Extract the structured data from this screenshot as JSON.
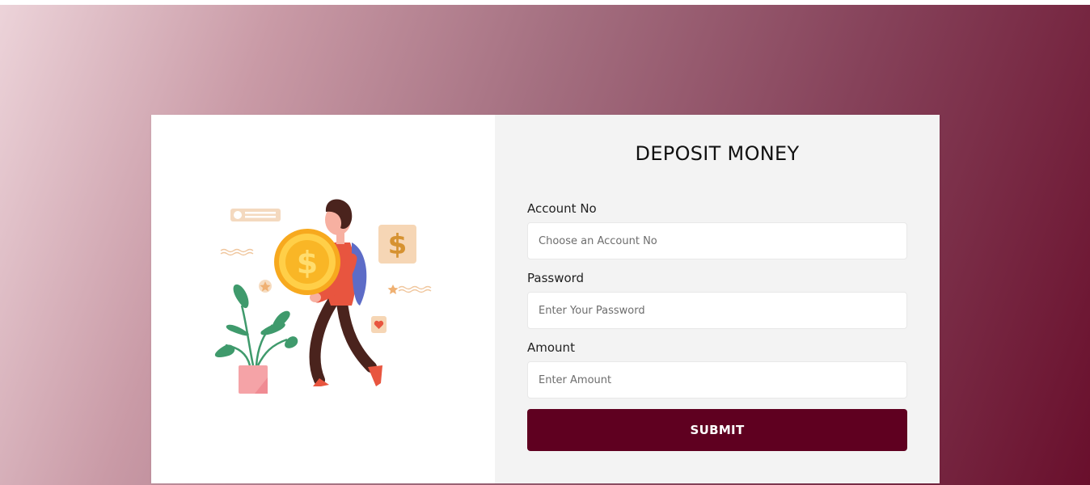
{
  "form": {
    "title": "DEPOSIT MONEY",
    "fields": [
      {
        "label": "Account No",
        "placeholder": "Choose an Account No"
      },
      {
        "label": "Password",
        "placeholder": "Enter Your Password"
      },
      {
        "label": "Amount",
        "placeholder": "Enter Amount"
      }
    ],
    "submit_label": "SUBMIT"
  },
  "illustration": {
    "icons": [
      "dollar-coin-icon",
      "dollar-card-icon",
      "heart-icon",
      "star-icon",
      "message-card-icon",
      "potted-plant"
    ]
  },
  "colors": {
    "accent": "#5f0020",
    "gradient_start": "#ecd3d9",
    "gradient_end": "#690f2c",
    "form_bg": "#f3f3f3"
  }
}
